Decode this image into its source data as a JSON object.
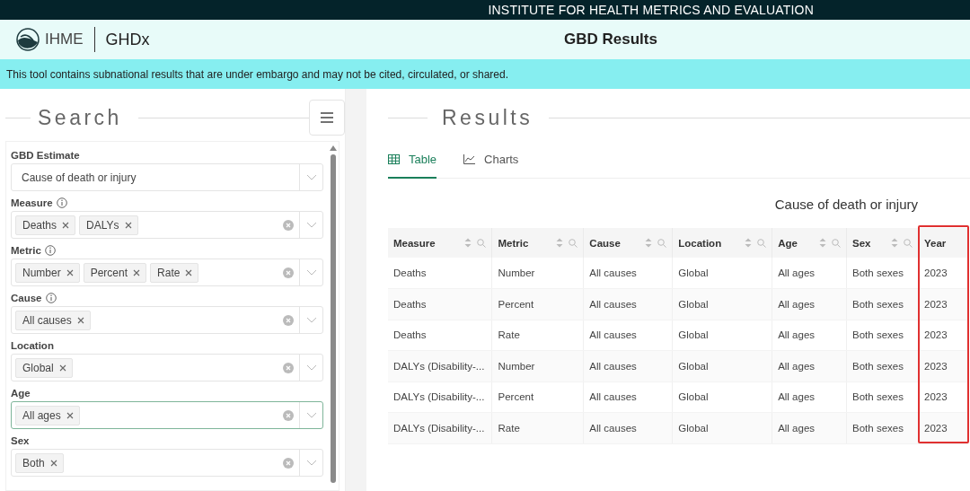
{
  "top_bar": {
    "title": "INSTITUTE FOR HEALTH METRICS AND EVALUATION"
  },
  "header": {
    "brand": "IHME",
    "product": "GHDx",
    "page_title": "GBD Results"
  },
  "banner": {
    "text": "This tool contains subnational results that are under embargo and may not be cited, circulated, or shared."
  },
  "search": {
    "title": "Search",
    "fields": [
      {
        "kind": "single",
        "label": "GBD Estimate",
        "info": false,
        "value": "Cause of death or injury",
        "focused": false
      },
      {
        "kind": "multi",
        "label": "Measure",
        "info": true,
        "tags": [
          "Deaths",
          "DALYs"
        ],
        "focused": false
      },
      {
        "kind": "multi",
        "label": "Metric",
        "info": true,
        "tags": [
          "Number",
          "Percent",
          "Rate"
        ],
        "focused": false
      },
      {
        "kind": "multi",
        "label": "Cause",
        "info": true,
        "tags": [
          "All causes"
        ],
        "focused": false
      },
      {
        "kind": "multi",
        "label": "Location",
        "info": false,
        "tags": [
          "Global"
        ],
        "focused": false
      },
      {
        "kind": "multi",
        "label": "Age",
        "info": false,
        "tags": [
          "All ages"
        ],
        "focused": true
      },
      {
        "kind": "multi",
        "label": "Sex",
        "info": false,
        "tags": [
          "Both"
        ],
        "focused": false
      }
    ]
  },
  "results": {
    "title": "Results",
    "tabs": [
      {
        "kind": "table",
        "label": "Table",
        "selected": true
      },
      {
        "kind": "chart",
        "label": "Charts",
        "selected": false
      }
    ],
    "table": {
      "caption": "Cause of death or injury",
      "columns": [
        {
          "label": "Measure",
          "sortable": true,
          "highlighted": false
        },
        {
          "label": "Metric",
          "sortable": true,
          "highlighted": false
        },
        {
          "label": "Cause",
          "sortable": true,
          "highlighted": false
        },
        {
          "label": "Location",
          "sortable": true,
          "highlighted": false
        },
        {
          "label": "Age",
          "sortable": true,
          "highlighted": false
        },
        {
          "label": "Sex",
          "sortable": true,
          "highlighted": false
        },
        {
          "label": "Year",
          "sortable": false,
          "highlighted": true
        }
      ],
      "rows": [
        [
          "Deaths",
          "Number",
          "All causes",
          "Global",
          "All ages",
          "Both sexes",
          "2023"
        ],
        [
          "Deaths",
          "Percent",
          "All causes",
          "Global",
          "All ages",
          "Both sexes",
          "2023"
        ],
        [
          "Deaths",
          "Rate",
          "All causes",
          "Global",
          "All ages",
          "Both sexes",
          "2023"
        ],
        [
          "DALYs (Disability-...",
          "Number",
          "All causes",
          "Global",
          "All ages",
          "Both sexes",
          "2023"
        ],
        [
          "DALYs (Disability-...",
          "Percent",
          "All causes",
          "Global",
          "All ages",
          "Both sexes",
          "2023"
        ],
        [
          "DALYs (Disability-...",
          "Rate",
          "All causes",
          "Global",
          "All ages",
          "Both sexes",
          "2023"
        ]
      ]
    }
  }
}
